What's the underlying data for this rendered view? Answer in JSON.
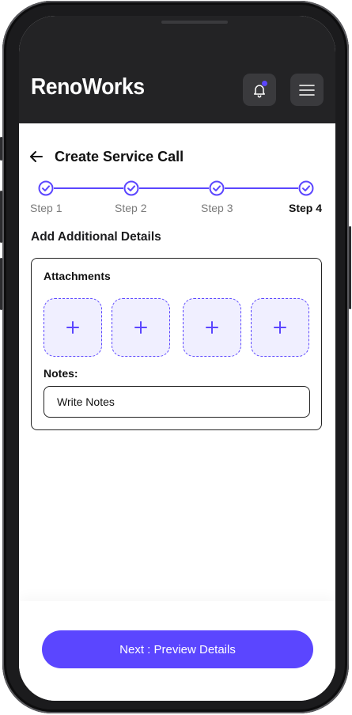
{
  "app": {
    "brand": "RenoWorks"
  },
  "header": {
    "bell_icon": "bell-icon",
    "menu_icon": "hamburger-icon"
  },
  "page": {
    "title": "Create Service Call",
    "back_icon": "arrow-left-icon"
  },
  "stepper": {
    "steps": [
      {
        "label": "Step 1",
        "completed": true
      },
      {
        "label": "Step 2",
        "completed": true
      },
      {
        "label": "Step 3",
        "completed": true
      },
      {
        "label": "Step 4",
        "completed": true,
        "active": true
      }
    ]
  },
  "section": {
    "title": "Add Additional Details"
  },
  "attachments": {
    "label": "Attachments",
    "slots": 4,
    "add_icon": "plus-icon"
  },
  "notes": {
    "label": "Notes:",
    "placeholder": "Write Notes",
    "value": ""
  },
  "footer": {
    "next_label": "Next : Preview Details"
  },
  "colors": {
    "accent": "#5b46ff",
    "header_bg": "#232325",
    "attach_bg": "#f0efff"
  }
}
